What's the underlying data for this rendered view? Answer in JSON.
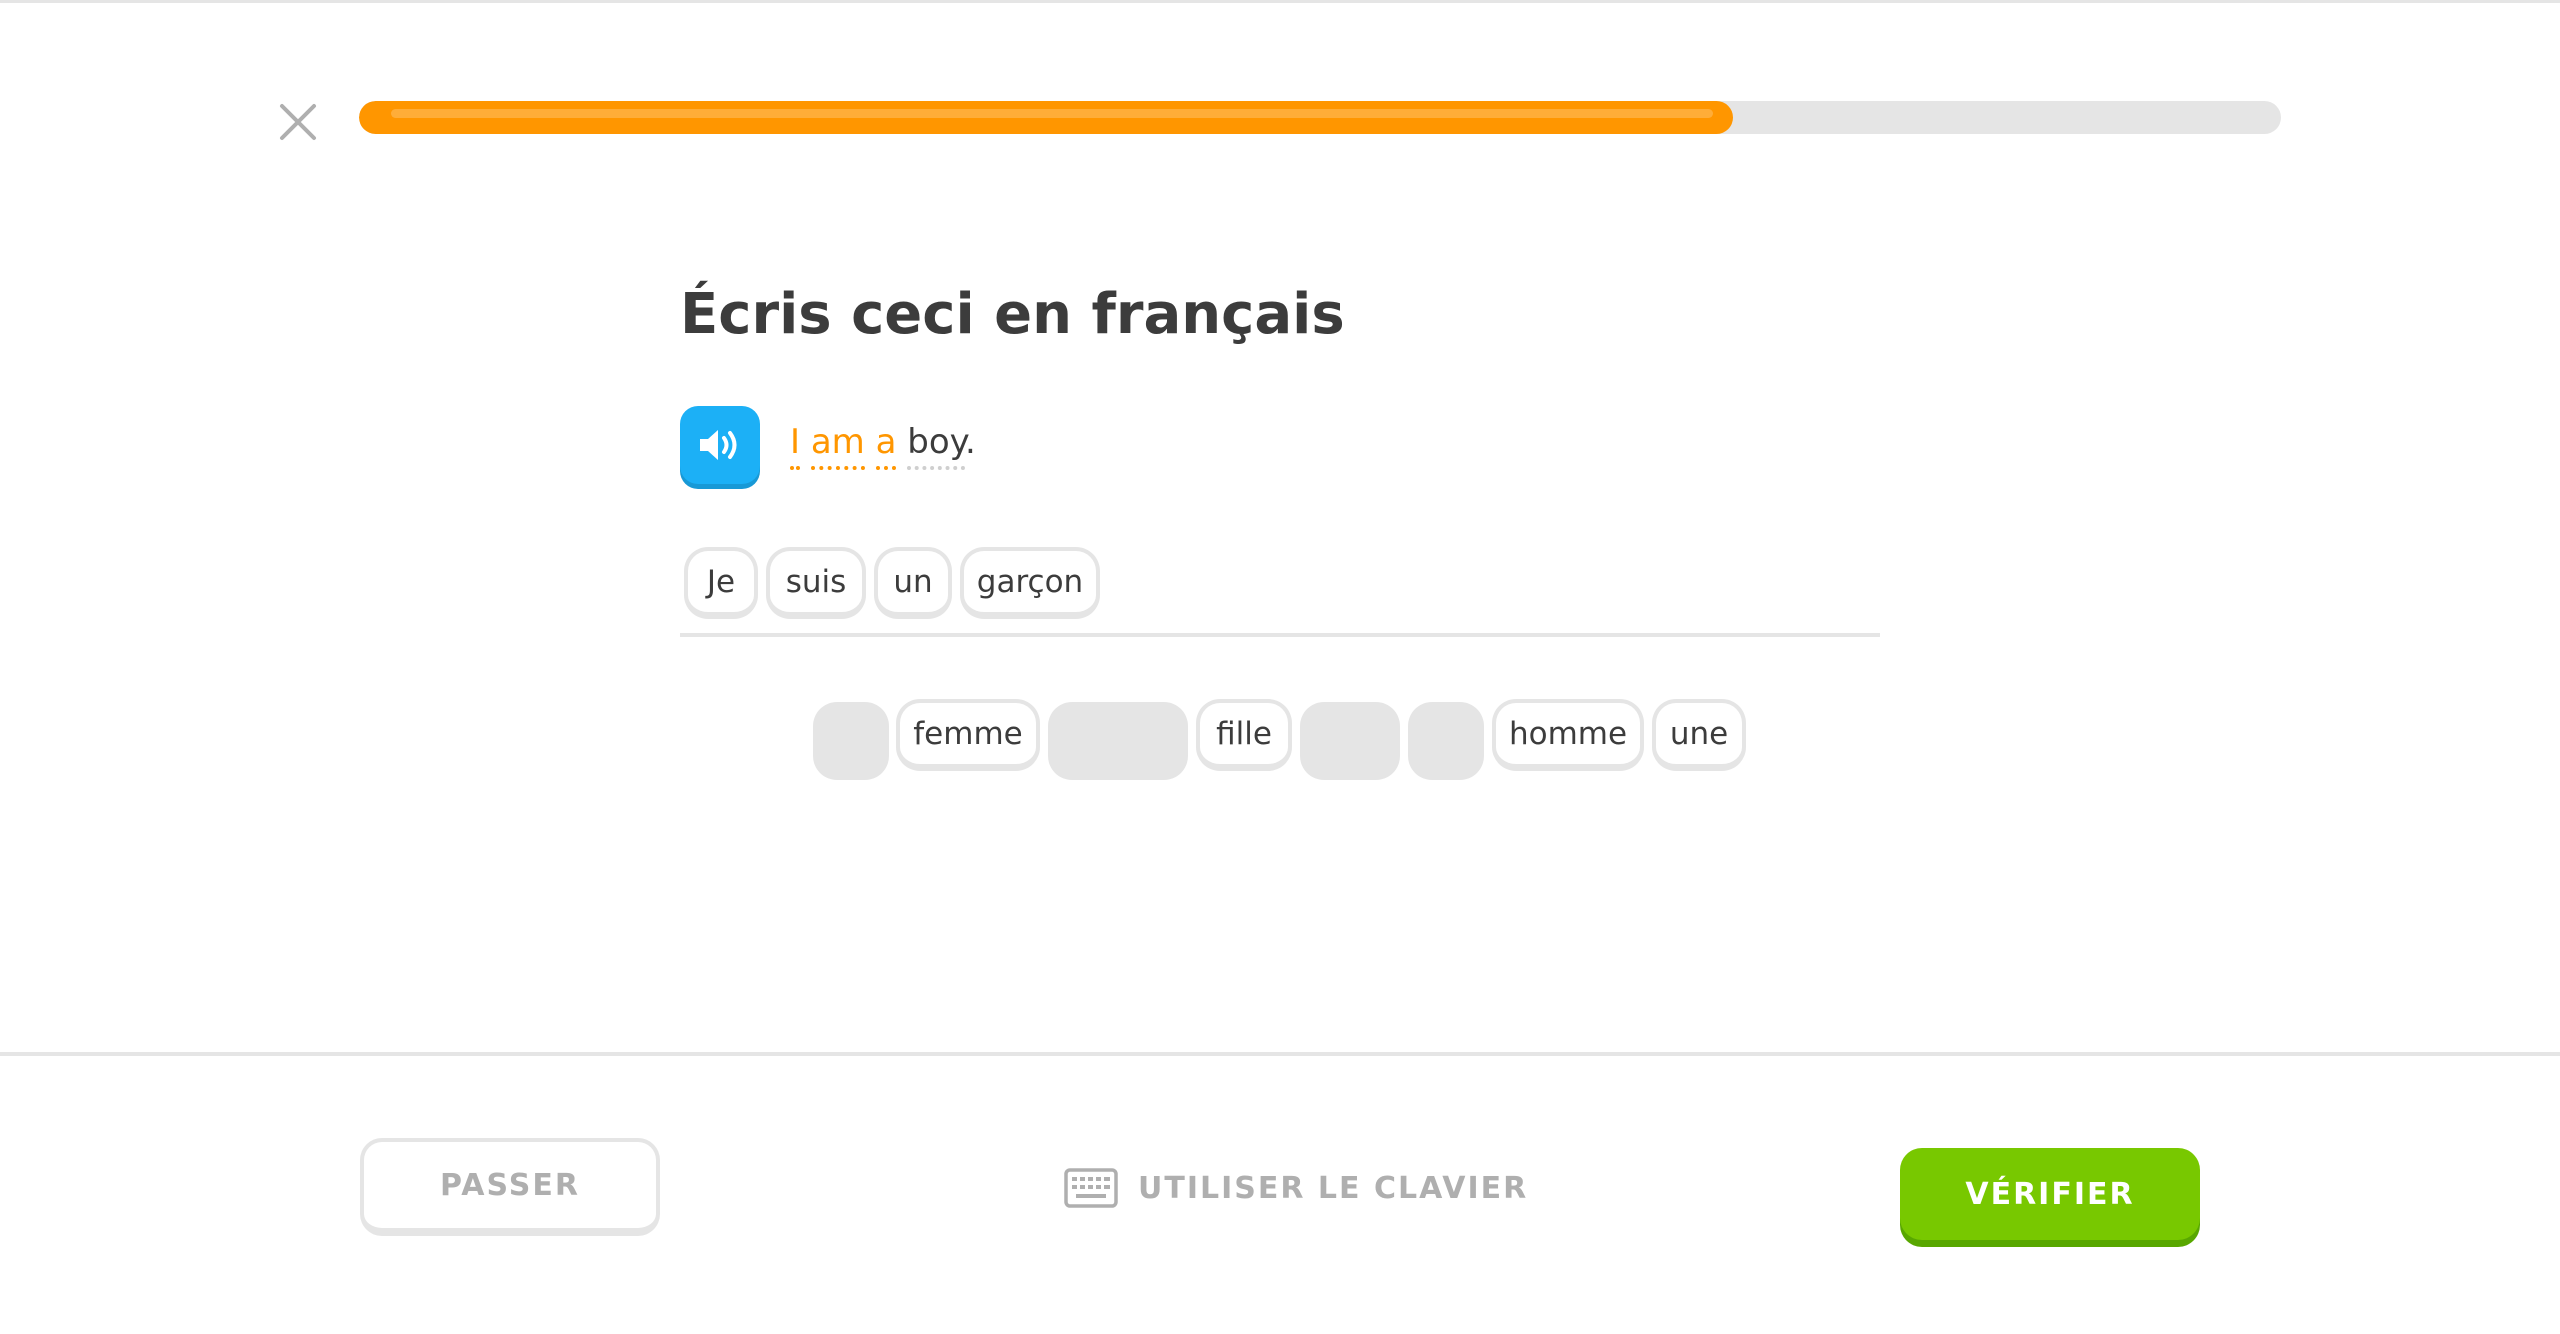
{
  "header": {
    "close_icon": "close-icon",
    "progress_fraction": 0.715,
    "progress_color": "#ff9600"
  },
  "challenge": {
    "title": "Écris ceci en français",
    "speaker_icon": "speaker-icon",
    "prompt_words": [
      {
        "text": "I",
        "hint": true
      },
      {
        "text": "am",
        "hint": true
      },
      {
        "text": "a",
        "hint": true
      },
      {
        "text": "boy",
        "hint": false
      }
    ],
    "prompt_punct": "."
  },
  "answer_tiles": [
    "Je",
    "suis",
    "un",
    "garçon"
  ],
  "word_bank": [
    {
      "label": "",
      "used": true
    },
    {
      "label": "femme",
      "used": false
    },
    {
      "label": "",
      "used": true
    },
    {
      "label": "fille",
      "used": false
    },
    {
      "label": "",
      "used": true
    },
    {
      "label": "",
      "used": true
    },
    {
      "label": "homme",
      "used": false
    },
    {
      "label": "une",
      "used": false
    }
  ],
  "footer": {
    "skip_label": "PASSER",
    "keyboard_icon": "keyboard-icon",
    "keyboard_label": "UTILISER LE CLAVIER",
    "check_label": "VÉRIFIER",
    "check_color": "#78c800"
  }
}
